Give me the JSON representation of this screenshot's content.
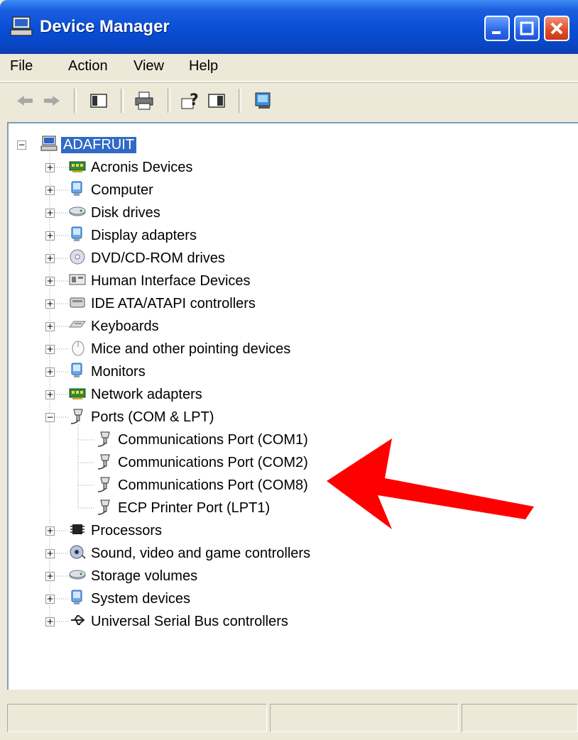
{
  "window": {
    "title": "Device Manager"
  },
  "menu": [
    "File",
    "Action",
    "View",
    "Help"
  ],
  "tree": {
    "root": "ADAFRUIT",
    "categories": [
      {
        "label": "Acronis Devices",
        "icon": "card-icon"
      },
      {
        "label": "Computer",
        "icon": "computer-icon"
      },
      {
        "label": "Disk drives",
        "icon": "disk-icon"
      },
      {
        "label": "Display adapters",
        "icon": "display-icon"
      },
      {
        "label": "DVD/CD-ROM drives",
        "icon": "cdrom-icon"
      },
      {
        "label": "Human Interface Devices",
        "icon": "hid-icon"
      },
      {
        "label": "IDE ATA/ATAPI controllers",
        "icon": "ide-icon"
      },
      {
        "label": "Keyboards",
        "icon": "keyboard-icon"
      },
      {
        "label": "Mice and other pointing devices",
        "icon": "mouse-icon"
      },
      {
        "label": "Monitors",
        "icon": "monitor-icon"
      },
      {
        "label": "Network adapters",
        "icon": "network-icon"
      },
      {
        "label": "Ports (COM & LPT)",
        "icon": "port-icon",
        "expanded": true,
        "children": [
          "Communications Port (COM1)",
          "Communications Port (COM2)",
          "Communications Port (COM8)",
          "ECP Printer Port (LPT1)"
        ]
      },
      {
        "label": "Processors",
        "icon": "cpu-icon"
      },
      {
        "label": "Sound, video and game controllers",
        "icon": "sound-icon"
      },
      {
        "label": "Storage volumes",
        "icon": "storage-icon"
      },
      {
        "label": "System devices",
        "icon": "system-icon"
      },
      {
        "label": "Universal Serial Bus controllers",
        "icon": "usb-icon"
      }
    ]
  },
  "colors": {
    "selection": "#316ac5",
    "arrow": "#ff0000",
    "titlebar": "#0a4fd6"
  }
}
